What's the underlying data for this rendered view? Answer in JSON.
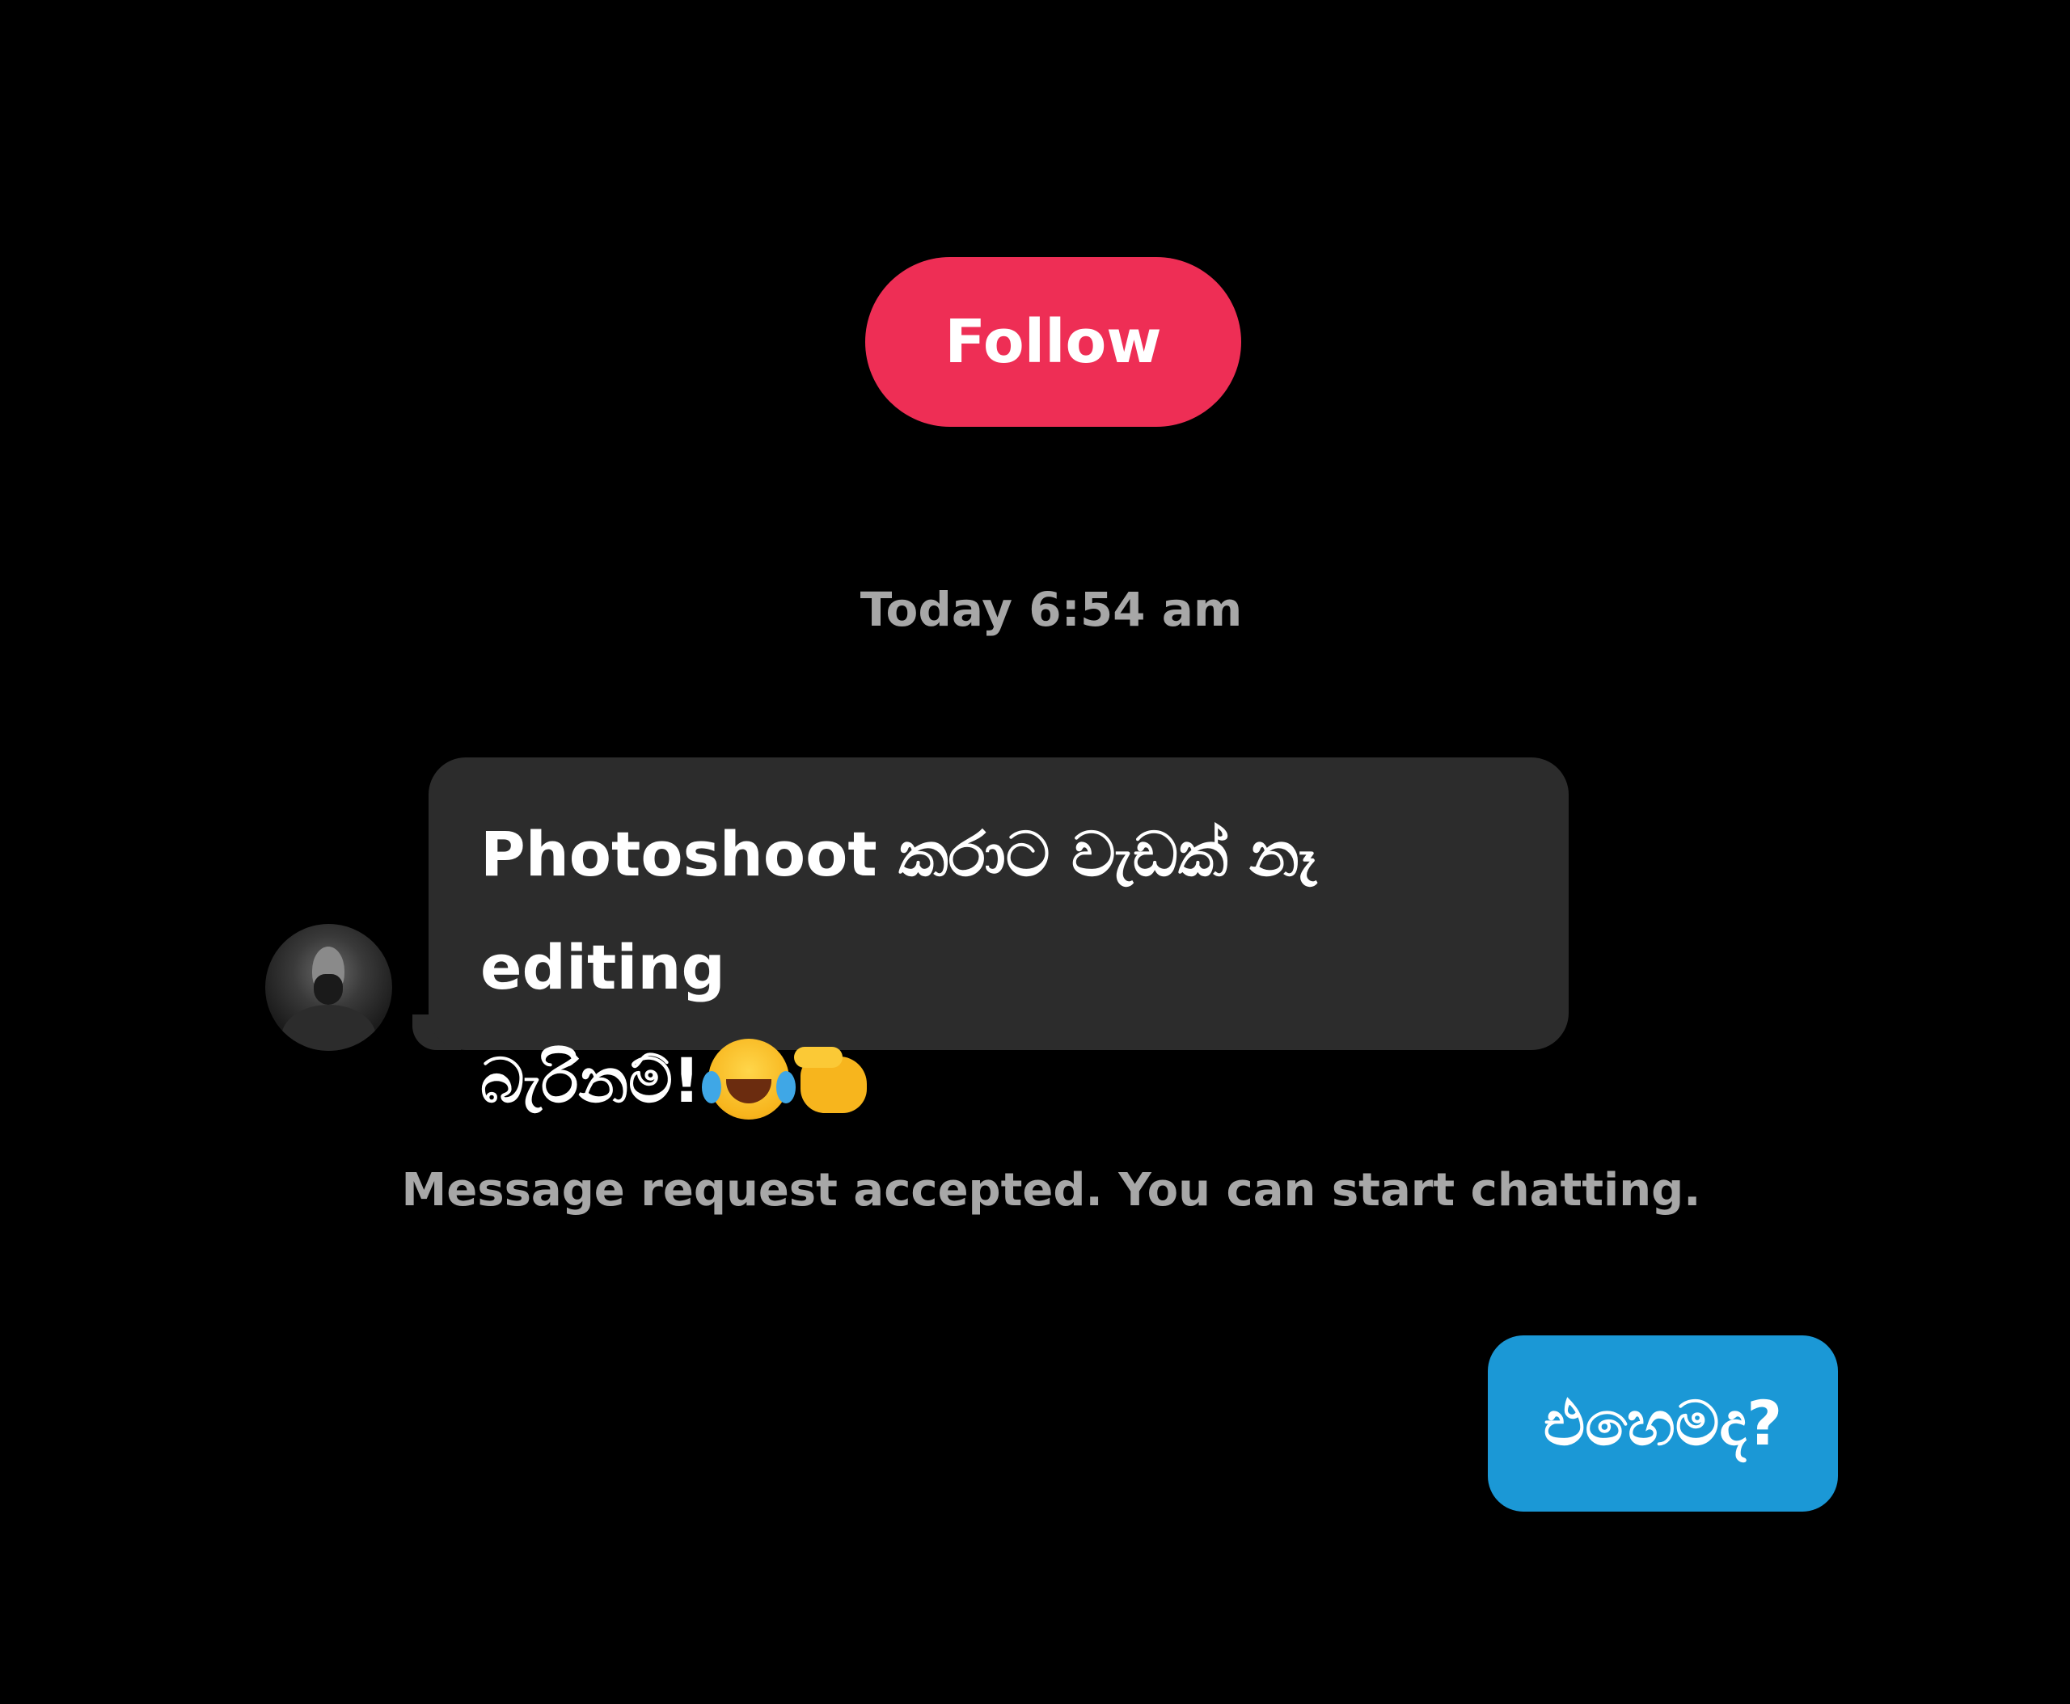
{
  "follow_button": {
    "label": "Follow",
    "color": "#ee2e55"
  },
  "timestamp": "Today 6:54 am",
  "incoming_message": {
    "line1": "Photoshoot කරාට වැඩක් නෑ editing",
    "line2": "බැරිනම්!",
    "emojis": [
      "laughing-with-tears-emoji",
      "fist-pointing-emoji"
    ],
    "bubble_color": "#2c2c2c"
  },
  "system_note": "Message request accepted. You can start chatting.",
  "outgoing_message": {
    "text": "එහෙමද?",
    "bubble_color": "#1b98d6"
  }
}
